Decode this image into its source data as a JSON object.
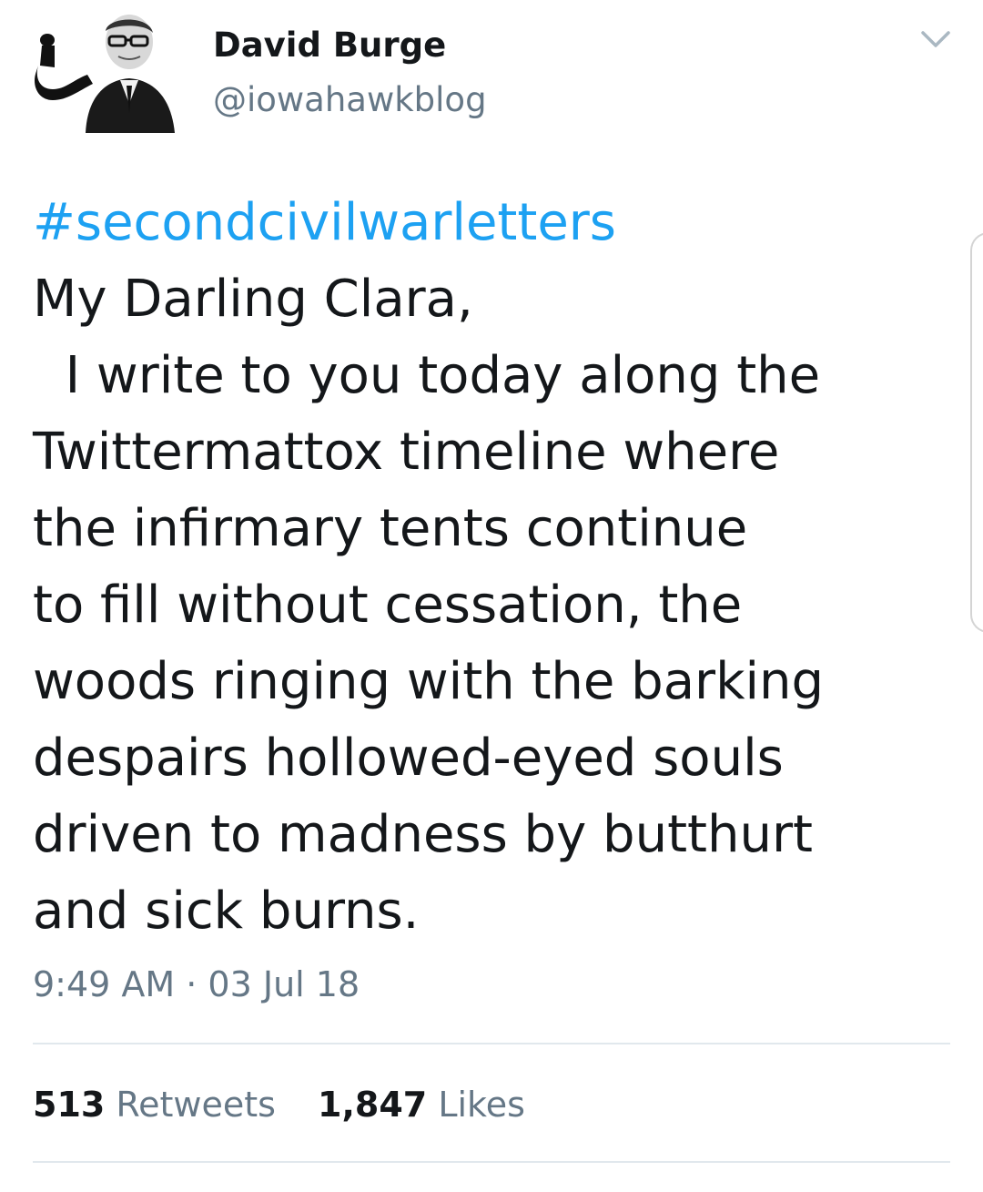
{
  "author": {
    "display_name": "David Burge",
    "handle": "@iowahawkblog"
  },
  "tweet": {
    "hashtag": "#secondcivilwarletters",
    "lines": [
      "My Darling Clara,",
      "  I write to you today along the",
      "Twittermattox timeline where",
      "the infirmary tents continue",
      "to fill without cessation, the",
      "woods ringing with the barking",
      "despairs hollowed-eyed souls",
      "driven to madness by butthurt",
      "and sick burns."
    ],
    "timestamp": "9:49 AM · 03 Jul 18"
  },
  "stats": {
    "retweets_count": "513",
    "retweets_label": "Retweets",
    "likes_count": "1,847",
    "likes_label": "Likes"
  },
  "colors": {
    "accent": "#1da1f2",
    "text": "#14171a",
    "secondary_text": "#657786",
    "divider": "#e1e8ed"
  },
  "icons": {
    "menu": "chevron-down-icon"
  }
}
